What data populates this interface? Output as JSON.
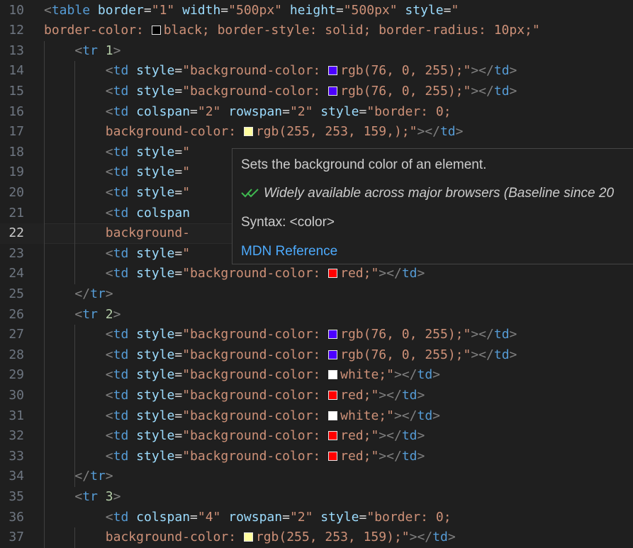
{
  "colors": {
    "background": "#1f1f1f",
    "tag": "#569cd6",
    "attribute": "#9cdcfe",
    "string": "#ce9178",
    "number": "#b5cea8",
    "punctuation": "#808080",
    "link": "#4daafc",
    "check": "#3fb950"
  },
  "editor": {
    "current_line": "22",
    "lines": [
      {
        "num": "10",
        "indent": 1,
        "tokens": [
          {
            "t": "<",
            "c": "punc"
          },
          {
            "t": "table",
            "c": "tag"
          },
          {
            "t": " "
          },
          {
            "t": "border",
            "c": "attr"
          },
          {
            "t": "="
          },
          {
            "t": "\"1\"",
            "c": "str"
          },
          {
            "t": " "
          },
          {
            "t": "width",
            "c": "attr"
          },
          {
            "t": "="
          },
          {
            "t": "\"500px\"",
            "c": "str"
          },
          {
            "t": " "
          },
          {
            "t": "height",
            "c": "attr"
          },
          {
            "t": "="
          },
          {
            "t": "\"500px\"",
            "c": "str"
          },
          {
            "t": " "
          },
          {
            "t": "style",
            "c": "attr"
          },
          {
            "t": "="
          },
          {
            "t": "\"",
            "c": "str"
          }
        ]
      },
      {
        "num": "12",
        "indent": 1,
        "tokens": [
          {
            "t": "border-color: ",
            "c": "str"
          },
          {
            "swatch": "#000000"
          },
          {
            "t": "black; border-style: solid; border-radius: 10px;\"",
            "c": "str"
          }
        ]
      },
      {
        "num": "13",
        "indent": 2,
        "tokens": [
          {
            "t": "<",
            "c": "punc"
          },
          {
            "t": "tr",
            "c": "tag"
          },
          {
            "t": " "
          },
          {
            "t": "1",
            "c": "num"
          },
          {
            "t": ">",
            "c": "punc"
          }
        ]
      },
      {
        "num": "14",
        "indent": 3,
        "tokens": [
          {
            "t": "<",
            "c": "punc"
          },
          {
            "t": "td",
            "c": "tag"
          },
          {
            "t": " "
          },
          {
            "t": "style",
            "c": "attr"
          },
          {
            "t": "="
          },
          {
            "t": "\"background-color: ",
            "c": "str"
          },
          {
            "swatch": "#4c00ff"
          },
          {
            "t": "rgb(76, 0, 255);\"",
            "c": "str"
          },
          {
            "t": "></",
            "c": "punc"
          },
          {
            "t": "td",
            "c": "tag"
          },
          {
            "t": ">",
            "c": "punc"
          }
        ]
      },
      {
        "num": "15",
        "indent": 3,
        "tokens": [
          {
            "t": "<",
            "c": "punc"
          },
          {
            "t": "td",
            "c": "tag"
          },
          {
            "t": " "
          },
          {
            "t": "style",
            "c": "attr"
          },
          {
            "t": "="
          },
          {
            "t": "\"background-color: ",
            "c": "str"
          },
          {
            "swatch": "#4c00ff"
          },
          {
            "t": "rgb(76, 0, 255);\"",
            "c": "str"
          },
          {
            "t": "></",
            "c": "punc"
          },
          {
            "t": "td",
            "c": "tag"
          },
          {
            "t": ">",
            "c": "punc"
          }
        ]
      },
      {
        "num": "16",
        "indent": 3,
        "tokens": [
          {
            "t": "<",
            "c": "punc"
          },
          {
            "t": "td",
            "c": "tag"
          },
          {
            "t": " "
          },
          {
            "t": "colspan",
            "c": "attr"
          },
          {
            "t": "="
          },
          {
            "t": "\"2\"",
            "c": "str"
          },
          {
            "t": " "
          },
          {
            "t": "rowspan",
            "c": "attr"
          },
          {
            "t": "="
          },
          {
            "t": "\"2\"",
            "c": "str"
          },
          {
            "t": " "
          },
          {
            "t": "style",
            "c": "attr"
          },
          {
            "t": "="
          },
          {
            "t": "\"border: 0;",
            "c": "str"
          }
        ]
      },
      {
        "num": "17",
        "indent": 3,
        "tokens": [
          {
            "t": "background-color: ",
            "c": "str"
          },
          {
            "swatch": "#fffd9f"
          },
          {
            "t": "rgb(255, 253, 159,);\"",
            "c": "str"
          },
          {
            "t": "></",
            "c": "punc"
          },
          {
            "t": "td",
            "c": "tag"
          },
          {
            "t": ">",
            "c": "punc"
          }
        ]
      },
      {
        "num": "18",
        "indent": 3,
        "tokens": [
          {
            "t": "<",
            "c": "punc"
          },
          {
            "t": "td",
            "c": "tag"
          },
          {
            "t": " "
          },
          {
            "t": "style",
            "c": "attr"
          },
          {
            "t": "="
          },
          {
            "t": "\"",
            "c": "str"
          }
        ]
      },
      {
        "num": "19",
        "indent": 3,
        "tokens": [
          {
            "t": "<",
            "c": "punc"
          },
          {
            "t": "td",
            "c": "tag"
          },
          {
            "t": " "
          },
          {
            "t": "style",
            "c": "attr"
          },
          {
            "t": "="
          },
          {
            "t": "\"",
            "c": "str"
          }
        ]
      },
      {
        "num": "20",
        "indent": 3,
        "tokens": [
          {
            "t": "<",
            "c": "punc"
          },
          {
            "t": "td",
            "c": "tag"
          },
          {
            "t": " "
          },
          {
            "t": "style",
            "c": "attr"
          },
          {
            "t": "="
          },
          {
            "t": "\"",
            "c": "str"
          }
        ]
      },
      {
        "num": "21",
        "indent": 3,
        "tokens": [
          {
            "t": "<",
            "c": "punc"
          },
          {
            "t": "td",
            "c": "tag"
          },
          {
            "t": " "
          },
          {
            "t": "colspan",
            "c": "attr"
          }
        ]
      },
      {
        "num": "22",
        "indent": 3,
        "tokens": [
          {
            "t": "background-",
            "c": "str"
          }
        ]
      },
      {
        "num": "23",
        "indent": 3,
        "tokens": [
          {
            "t": "<",
            "c": "punc"
          },
          {
            "t": "td",
            "c": "tag"
          },
          {
            "t": " "
          },
          {
            "t": "style",
            "c": "attr"
          },
          {
            "t": "="
          },
          {
            "t": "\"",
            "c": "str"
          }
        ]
      },
      {
        "num": "24",
        "indent": 3,
        "tokens": [
          {
            "t": "<",
            "c": "punc"
          },
          {
            "t": "td",
            "c": "tag"
          },
          {
            "t": " "
          },
          {
            "t": "style",
            "c": "attr"
          },
          {
            "t": "="
          },
          {
            "t": "\"background-color: ",
            "c": "str"
          },
          {
            "swatch": "#ff0000"
          },
          {
            "t": "red;\"",
            "c": "str"
          },
          {
            "t": "></",
            "c": "punc"
          },
          {
            "t": "td",
            "c": "tag"
          },
          {
            "t": ">",
            "c": "punc"
          }
        ]
      },
      {
        "num": "25",
        "indent": 2,
        "tokens": [
          {
            "t": "</",
            "c": "punc"
          },
          {
            "t": "tr",
            "c": "tag"
          },
          {
            "t": ">",
            "c": "punc"
          }
        ]
      },
      {
        "num": "26",
        "indent": 2,
        "tokens": [
          {
            "t": "<",
            "c": "punc"
          },
          {
            "t": "tr",
            "c": "tag"
          },
          {
            "t": " "
          },
          {
            "t": "2",
            "c": "num"
          },
          {
            "t": ">",
            "c": "punc"
          }
        ]
      },
      {
        "num": "27",
        "indent": 3,
        "tokens": [
          {
            "t": "<",
            "c": "punc"
          },
          {
            "t": "td",
            "c": "tag"
          },
          {
            "t": " "
          },
          {
            "t": "style",
            "c": "attr"
          },
          {
            "t": "="
          },
          {
            "t": "\"background-color: ",
            "c": "str"
          },
          {
            "swatch": "#4c00ff"
          },
          {
            "t": "rgb(76, 0, 255);\"",
            "c": "str"
          },
          {
            "t": "></",
            "c": "punc"
          },
          {
            "t": "td",
            "c": "tag"
          },
          {
            "t": ">",
            "c": "punc"
          }
        ]
      },
      {
        "num": "28",
        "indent": 3,
        "tokens": [
          {
            "t": "<",
            "c": "punc"
          },
          {
            "t": "td",
            "c": "tag"
          },
          {
            "t": " "
          },
          {
            "t": "style",
            "c": "attr"
          },
          {
            "t": "="
          },
          {
            "t": "\"background-color: ",
            "c": "str"
          },
          {
            "swatch": "#4c00ff"
          },
          {
            "t": "rgb(76, 0, 255);\"",
            "c": "str"
          },
          {
            "t": "></",
            "c": "punc"
          },
          {
            "t": "td",
            "c": "tag"
          },
          {
            "t": ">",
            "c": "punc"
          }
        ]
      },
      {
        "num": "29",
        "indent": 3,
        "tokens": [
          {
            "t": "<",
            "c": "punc"
          },
          {
            "t": "td",
            "c": "tag"
          },
          {
            "t": " "
          },
          {
            "t": "style",
            "c": "attr"
          },
          {
            "t": "="
          },
          {
            "t": "\"background-color: ",
            "c": "str"
          },
          {
            "swatch": "#ffffff"
          },
          {
            "t": "white;\"",
            "c": "str"
          },
          {
            "t": "></",
            "c": "punc"
          },
          {
            "t": "td",
            "c": "tag"
          },
          {
            "t": ">",
            "c": "punc"
          }
        ]
      },
      {
        "num": "30",
        "indent": 3,
        "tokens": [
          {
            "t": "<",
            "c": "punc"
          },
          {
            "t": "td",
            "c": "tag"
          },
          {
            "t": " "
          },
          {
            "t": "style",
            "c": "attr"
          },
          {
            "t": "="
          },
          {
            "t": "\"background-color: ",
            "c": "str"
          },
          {
            "swatch": "#ff0000"
          },
          {
            "t": "red;\"",
            "c": "str"
          },
          {
            "t": "></",
            "c": "punc"
          },
          {
            "t": "td",
            "c": "tag"
          },
          {
            "t": ">",
            "c": "punc"
          }
        ]
      },
      {
        "num": "31",
        "indent": 3,
        "tokens": [
          {
            "t": "<",
            "c": "punc"
          },
          {
            "t": "td",
            "c": "tag"
          },
          {
            "t": " "
          },
          {
            "t": "style",
            "c": "attr"
          },
          {
            "t": "="
          },
          {
            "t": "\"background-color: ",
            "c": "str"
          },
          {
            "swatch": "#ffffff"
          },
          {
            "t": "white;\"",
            "c": "str"
          },
          {
            "t": "></",
            "c": "punc"
          },
          {
            "t": "td",
            "c": "tag"
          },
          {
            "t": ">",
            "c": "punc"
          }
        ]
      },
      {
        "num": "32",
        "indent": 3,
        "tokens": [
          {
            "t": "<",
            "c": "punc"
          },
          {
            "t": "td",
            "c": "tag"
          },
          {
            "t": " "
          },
          {
            "t": "style",
            "c": "attr"
          },
          {
            "t": "="
          },
          {
            "t": "\"background-color: ",
            "c": "str"
          },
          {
            "swatch": "#ff0000"
          },
          {
            "t": "red;\"",
            "c": "str"
          },
          {
            "t": "></",
            "c": "punc"
          },
          {
            "t": "td",
            "c": "tag"
          },
          {
            "t": ">",
            "c": "punc"
          }
        ]
      },
      {
        "num": "33",
        "indent": 3,
        "tokens": [
          {
            "t": "<",
            "c": "punc"
          },
          {
            "t": "td",
            "c": "tag"
          },
          {
            "t": " "
          },
          {
            "t": "style",
            "c": "attr"
          },
          {
            "t": "="
          },
          {
            "t": "\"background-color: ",
            "c": "str"
          },
          {
            "swatch": "#ff0000"
          },
          {
            "t": "red;\"",
            "c": "str"
          },
          {
            "t": "></",
            "c": "punc"
          },
          {
            "t": "td",
            "c": "tag"
          },
          {
            "t": ">",
            "c": "punc"
          }
        ]
      },
      {
        "num": "34",
        "indent": 2,
        "tokens": [
          {
            "t": "</",
            "c": "punc"
          },
          {
            "t": "tr",
            "c": "tag"
          },
          {
            "t": ">",
            "c": "punc"
          }
        ]
      },
      {
        "num": "35",
        "indent": 2,
        "tokens": [
          {
            "t": "<",
            "c": "punc"
          },
          {
            "t": "tr",
            "c": "tag"
          },
          {
            "t": " "
          },
          {
            "t": "3",
            "c": "num"
          },
          {
            "t": ">",
            "c": "punc"
          }
        ]
      },
      {
        "num": "36",
        "indent": 3,
        "tokens": [
          {
            "t": "<",
            "c": "punc"
          },
          {
            "t": "td",
            "c": "tag"
          },
          {
            "t": " "
          },
          {
            "t": "colspan",
            "c": "attr"
          },
          {
            "t": "="
          },
          {
            "t": "\"4\"",
            "c": "str"
          },
          {
            "t": " "
          },
          {
            "t": "rowspan",
            "c": "attr"
          },
          {
            "t": "="
          },
          {
            "t": "\"2\"",
            "c": "str"
          },
          {
            "t": " "
          },
          {
            "t": "style",
            "c": "attr"
          },
          {
            "t": "="
          },
          {
            "t": "\"border: 0;",
            "c": "str"
          }
        ]
      },
      {
        "num": "37",
        "indent": 3,
        "tokens": [
          {
            "t": "background-color: ",
            "c": "str"
          },
          {
            "swatch": "#fffd9f"
          },
          {
            "t": "rgb(255, 253, 159);\"",
            "c": "str"
          },
          {
            "t": "></",
            "c": "punc"
          },
          {
            "t": "td",
            "c": "tag"
          },
          {
            "t": ">",
            "c": "punc"
          }
        ]
      }
    ]
  },
  "hover": {
    "description": "Sets the background color of an element.",
    "baseline": "Widely available across major browsers (Baseline since 20",
    "syntax": "Syntax: <color>",
    "link_text": "MDN Reference",
    "check_icon": "double-check-icon"
  }
}
